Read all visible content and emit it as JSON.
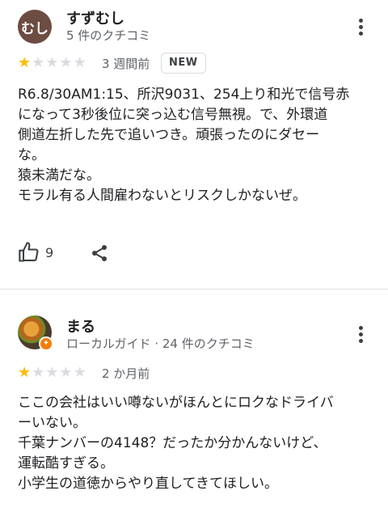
{
  "reviews": [
    {
      "avatar_text": "むし",
      "avatar_color": "#6d4c41",
      "name": "すずむし",
      "meta": "5 件のクチコミ",
      "rating": 1,
      "age": "3 週間前",
      "new_badge": "NEW",
      "body": [
        "R6.8/30AM1:15、所沢9031、254上り和光で信号赤",
        "になって3秒後位に突っ込む信号無視。で、外環道",
        "側道左折した先で追いつき。頑張ったのにダセー",
        "な。",
        "猿未満だな。",
        "モラル有る人間雇わないとリスクしかないぜ。"
      ],
      "like_count": "9"
    },
    {
      "name": "まる",
      "meta": "ローカルガイド · 24 件のクチコミ",
      "rating": 1,
      "age": "2 か月前",
      "body": [
        "ここの会社はいい噂ないがほんとにロクなドライバ",
        "ーいない。",
        "千葉ナンバーの4148？だったか分かんないけど、",
        "運転酷すぎる。",
        "小学生の道徳からやり直してきてほしい。"
      ]
    }
  ],
  "icons": {
    "more": "more-vert-icon",
    "like": "thumb-up-icon",
    "share": "share-icon",
    "local_guide": "local-guide-badge-icon",
    "star": "star-icon"
  },
  "colors": {
    "star_on": "#fbbc04",
    "star_off": "#dadce0",
    "local_guide_badge": "#f57c00"
  }
}
